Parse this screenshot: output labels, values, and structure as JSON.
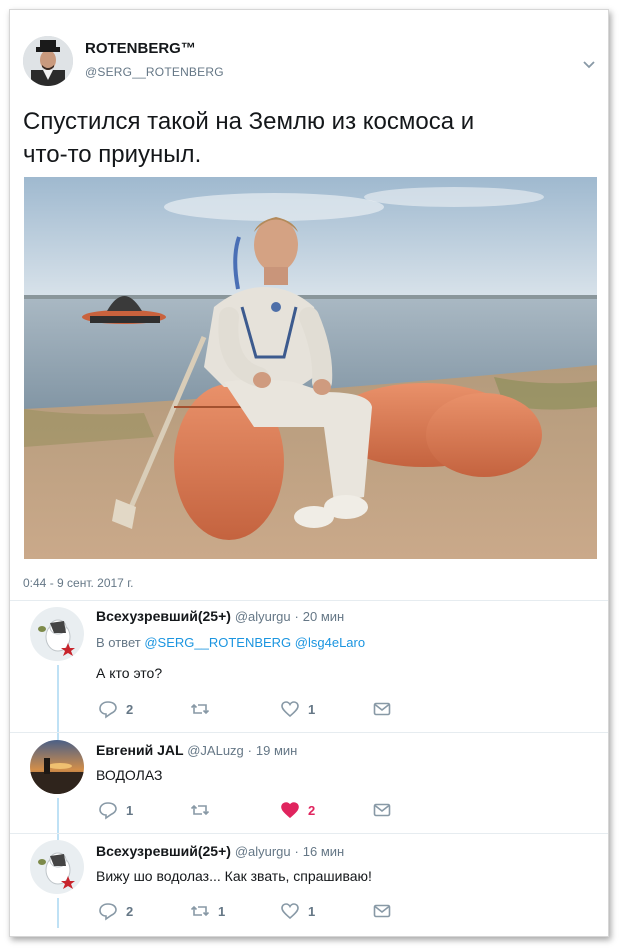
{
  "tweet": {
    "author_name": "ROTENBERG™",
    "author_handle": "@SERG__ROTENBERG",
    "text_line1": "Спустился такой на Землю из космоса и",
    "text_line2": "что-то приуныл.",
    "timestamp": "0:44 - 9 сент. 2017 г.",
    "photo_alt": "cosmonaut in spacesuit sitting on orange inflatable raft on a river bank, landing capsule floating on water"
  },
  "replies": [
    {
      "name": "Всехузревший(25+)",
      "handle": "@alyurgu",
      "dot": "·",
      "time": "20 мин",
      "reply_prefix": "В ответ",
      "reply_to_1": "@SERG__ROTENBERG",
      "reply_to_2": "@lsg4eLaro",
      "text": "А кто это?",
      "replies_count": "2",
      "retweets_count": "",
      "likes_count": "1",
      "liked": false
    },
    {
      "name": "Евгений JAL",
      "handle": "@JALuzg",
      "dot": "·",
      "time": "19 мин",
      "text": "ВОДОЛАЗ",
      "replies_count": "1",
      "retweets_count": "",
      "likes_count": "2",
      "liked": true
    },
    {
      "name": "Всехузревший(25+)",
      "handle": "@alyurgu",
      "dot": "·",
      "time": "16 мин",
      "text": "Вижу шо водолаз... Как звать, спрашиваю!",
      "replies_count": "2",
      "retweets_count": "1",
      "likes_count": "1",
      "liked": false
    }
  ],
  "icons": {
    "reply": "reply-icon",
    "retweet": "retweet-icon",
    "like": "heart-icon",
    "message": "envelope-icon",
    "menu": "chevron-down-icon"
  },
  "colors": {
    "link": "#1b95e0",
    "muted": "#657786",
    "like": "#e0245e",
    "thread": "#bfe1f5"
  }
}
